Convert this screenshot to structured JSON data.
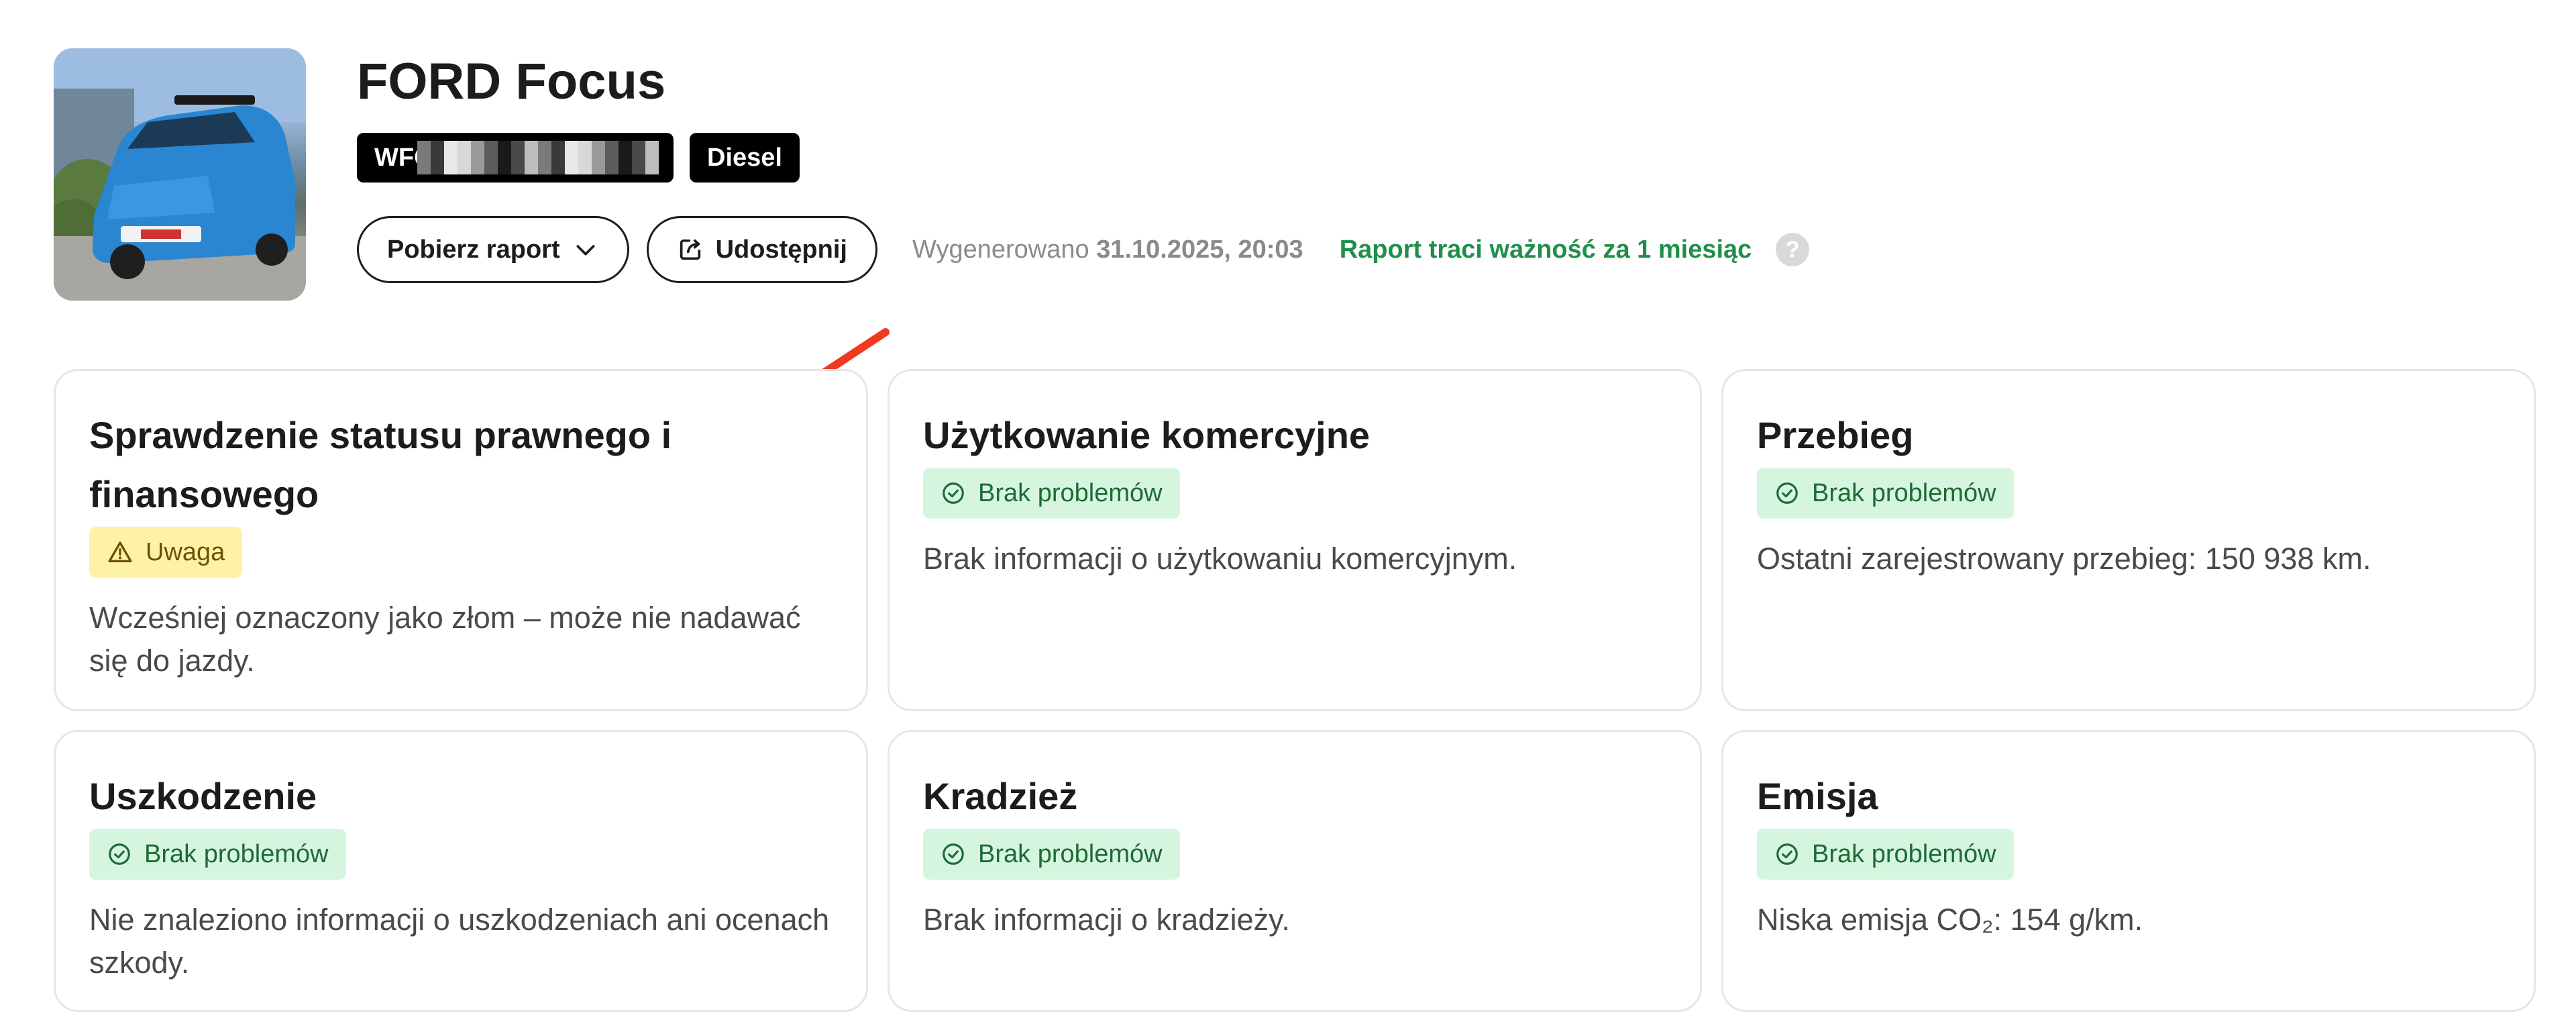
{
  "vehicle": {
    "title": "FORD Focus",
    "vin_prefix": "WFC",
    "fuel": "Diesel"
  },
  "actions": {
    "download_label": "Pobierz raport",
    "share_label": "Udostępnij"
  },
  "meta": {
    "generated_label": "Wygenerowano",
    "generated_date": "31.10.2025, 20:03",
    "expiry_text": "Raport traci ważność za 1 miesiąc",
    "help_glyph": "?"
  },
  "colors": {
    "ok_bg": "#d6f5df",
    "ok_text": "#1d6b36",
    "warn_bg": "#fdf2a6",
    "warn_text": "#6b5200",
    "expiry_green": "#1f8f4a",
    "annotation_arrow": "#f0391f"
  },
  "cards": [
    {
      "title": "Sprawdzenie statusu prawnego i finansowego",
      "status": "warn",
      "status_label": "Uwaga",
      "status_icon": "warning-triangle-icon",
      "description": "Wcześniej oznaczony jako złom – może nie nadawać się do jazdy."
    },
    {
      "title": "Użytkowanie komercyjne",
      "status": "ok",
      "status_label": "Brak problemów",
      "status_icon": "check-circle-icon",
      "description": "Brak informacji o użytkowaniu komercyjnym."
    },
    {
      "title": "Przebieg",
      "status": "ok",
      "status_label": "Brak problemów",
      "status_icon": "check-circle-icon",
      "description": "Ostatni zarejestrowany przebieg: 150 938 km."
    },
    {
      "title": "Uszkodzenie",
      "status": "ok",
      "status_label": "Brak problemów",
      "status_icon": "check-circle-icon",
      "description": "Nie znaleziono informacji o uszkodzeniach ani ocenach szkody."
    },
    {
      "title": "Kradzież",
      "status": "ok",
      "status_label": "Brak problemów",
      "status_icon": "check-circle-icon",
      "description": "Brak informacji o kradzieży."
    },
    {
      "title": "Emisja",
      "status": "ok",
      "status_label": "Brak problemów",
      "status_icon": "check-circle-icon",
      "description": "Niska emisja CO₂: 154 g/km."
    }
  ]
}
